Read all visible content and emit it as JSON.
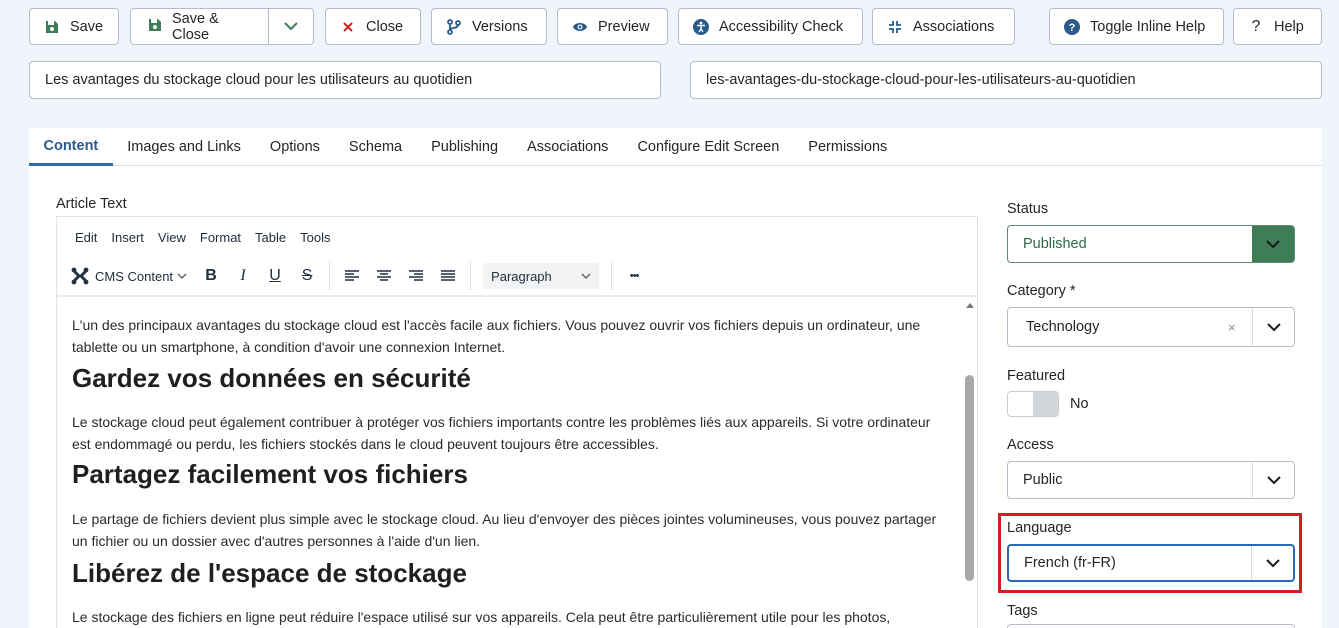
{
  "toolbar": {
    "save": "Save",
    "save_close": "Save & Close",
    "close": "Close",
    "versions": "Versions",
    "preview": "Preview",
    "accessibility": "Accessibility Check",
    "associations": "Associations",
    "inline_help": "Toggle Inline Help",
    "help": "Help"
  },
  "title_value": "Les avantages du stockage cloud pour les utilisateurs au quotidien",
  "alias_value": "les-avantages-du-stockage-cloud-pour-les-utilisateurs-au-quotidien",
  "tabs": [
    "Content",
    "Images and Links",
    "Options",
    "Schema",
    "Publishing",
    "Associations",
    "Configure Edit Screen",
    "Permissions"
  ],
  "editor": {
    "label": "Article Text",
    "menu": [
      "Edit",
      "Insert",
      "View",
      "Format",
      "Table",
      "Tools"
    ],
    "cms_content": "CMS Content",
    "block_format": "Paragraph",
    "more": "•••",
    "body": {
      "p1": "L'un des principaux avantages du stockage cloud est l'accès facile aux fichiers. Vous pouvez ouvrir vos fichiers depuis un ordinateur, une tablette ou un smartphone, à condition d'avoir une connexion Internet.",
      "h1": "Gardez vos données en sécurité",
      "p2": "Le stockage cloud peut également contribuer à protéger vos fichiers importants contre les problèmes liés aux appareils. Si votre ordinateur est endommagé ou perdu, les fichiers stockés dans le cloud peuvent toujours être accessibles.",
      "h2": "Partagez facilement vos fichiers",
      "p3": "Le partage de fichiers devient plus simple avec le stockage cloud. Au lieu d'envoyer des pièces jointes volumineuses, vous pouvez partager un fichier ou un dossier avec d'autres personnes à l'aide d'un lien.",
      "h3": "Libérez de l'espace de stockage",
      "p4": "Le stockage des fichiers en ligne peut réduire l'espace utilisé sur vos appareils. Cela peut être particulièrement utile pour les photos,"
    }
  },
  "sidebar": {
    "status_label": "Status",
    "status_value": "Published",
    "category_label": "Category *",
    "category_value": "Technology",
    "category_clear": "×",
    "featured_label": "Featured",
    "featured_value": "No",
    "access_label": "Access",
    "access_value": "Public",
    "language_label": "Language",
    "language_value": "French (fr-FR)",
    "tags_label": "Tags"
  },
  "colors": {
    "accent": "#2a69b8",
    "published": "#3e7d55",
    "highlight": "#d51c23"
  }
}
